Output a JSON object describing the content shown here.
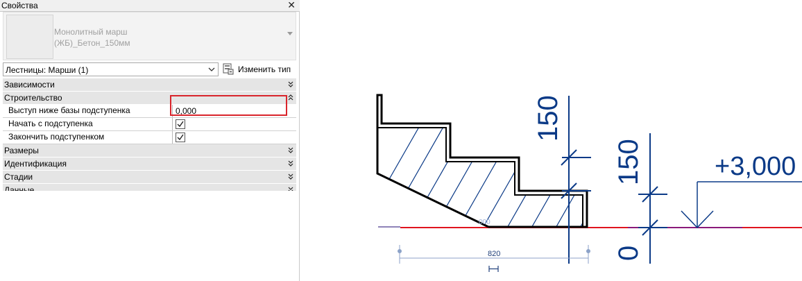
{
  "palette": {
    "title": "Свойства",
    "close_symbol": "✕",
    "type_name_line1": "Монолитный марш",
    "type_name_line2": "(ЖБ)_Бетон_150мм",
    "filter_label": "Лестницы: Марши (1)",
    "edit_type_label": "Изменить тип",
    "categories": {
      "constraints": "Зависимости",
      "construction": "Строительство",
      "dimensions": "Размеры",
      "identity": "Идентификация",
      "phasing": "Стадии",
      "data": "Данные"
    },
    "params": {
      "riser_offset_label": "Выступ ниже базы подступенка",
      "riser_offset_value": "0,000",
      "begin_with_riser_label": "Начать с подступенка",
      "begin_with_riser_checked": true,
      "end_with_riser_label": "Закончить подступенком",
      "end_with_riser_checked": true
    }
  },
  "drawing": {
    "dim_riser_upper": "150",
    "dim_riser_lower": "150",
    "dim_zero": "0",
    "elevation_label": "+3,000",
    "run_width": "820",
    "faint_label": "000",
    "colors": {
      "line": "#000000",
      "dim": "#0b3a87",
      "level_red": "#e0141e",
      "level_purple": "#8a1a7a"
    }
  }
}
